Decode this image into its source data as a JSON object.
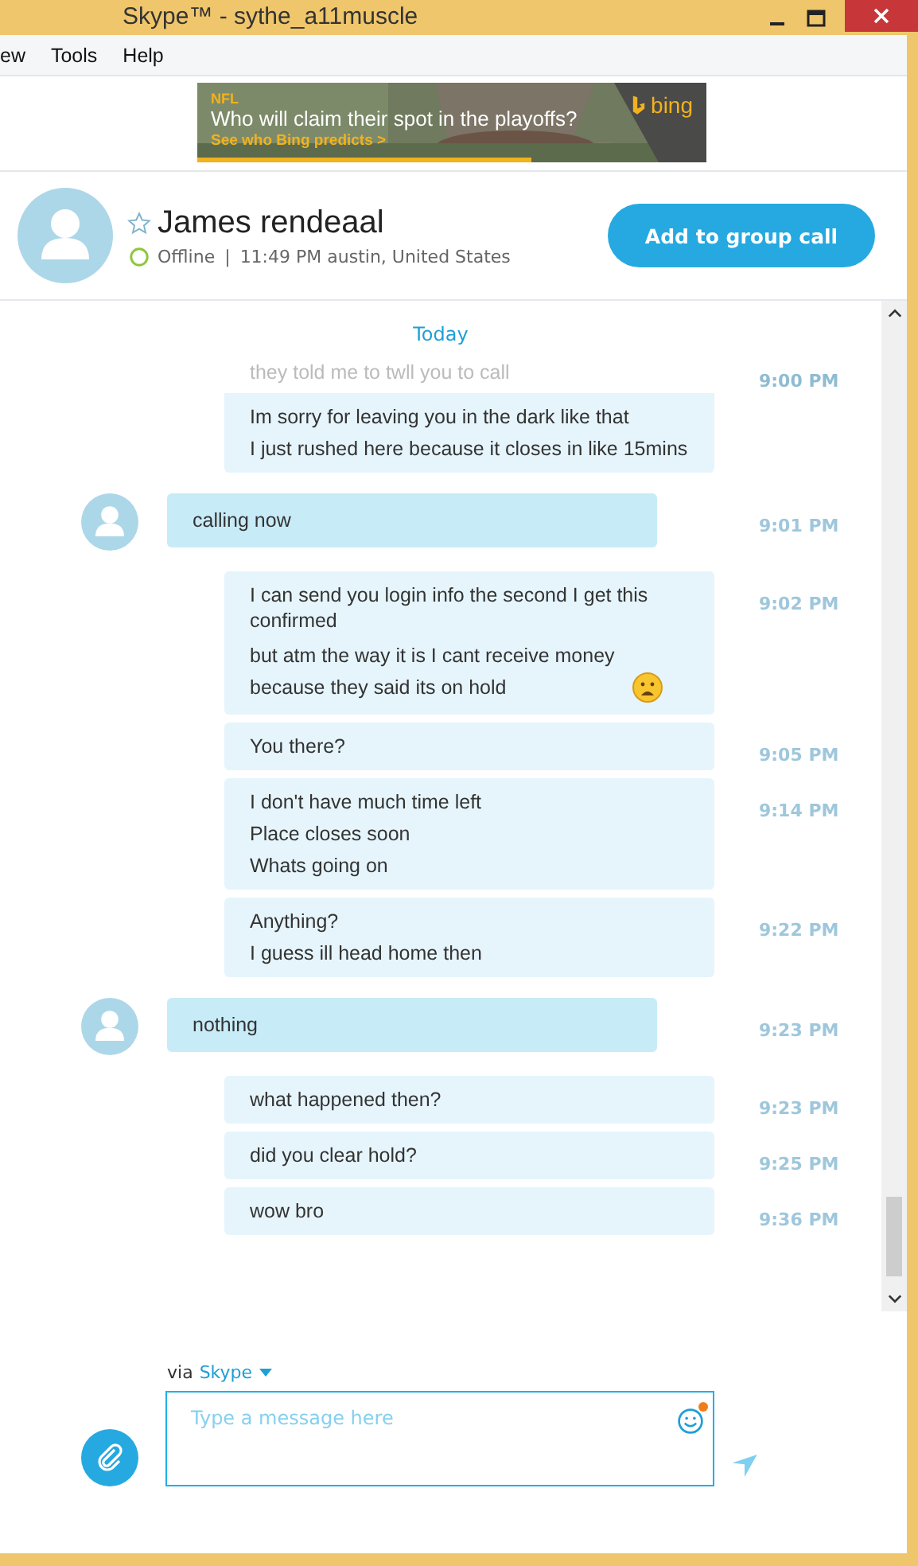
{
  "window": {
    "title": "Skype™ - sythe_a11muscle"
  },
  "menu": [
    "ew",
    "Tools",
    "Help"
  ],
  "ad": {
    "tag": "NFL",
    "headline": "Who will claim their spot in the playoffs?",
    "link": "See who Bing predicts >",
    "brand": "bing"
  },
  "contact": {
    "name": "James rendeaal",
    "favorite": false,
    "status": "Offline",
    "separator": "|",
    "local_time": "11:49 PM austin, United States",
    "action": "Add to group call"
  },
  "day_label": "Today",
  "messages": [
    {
      "kind": "outgoing",
      "cut": true,
      "lines": [
        "they told me to twll you to call"
      ],
      "time": "9:00 PM"
    },
    {
      "kind": "outgoing",
      "cut": false,
      "lines": [
        "Im sorry for leaving you in the dark like that",
        "I just rushed here because it closes in like 15mins"
      ]
    },
    {
      "kind": "incoming",
      "lines": [
        "calling now"
      ],
      "time": "9:01 PM"
    },
    {
      "kind": "outgoing",
      "lines": [
        "I can send you login info the second I get this confirmed",
        "but atm the way it is I cant receive money because they said its on hold"
      ],
      "emoticon": true,
      "time": "9:02 PM"
    },
    {
      "kind": "outgoing",
      "lines": [
        "You there?"
      ],
      "time": "9:05 PM"
    },
    {
      "kind": "outgoing",
      "lines": [
        "I don't have much time left",
        "Place closes soon",
        "Whats going on"
      ],
      "time": "9:14 PM"
    },
    {
      "kind": "outgoing",
      "lines": [
        "Anything?",
        "I guess ill head home then"
      ],
      "time": "9:22 PM"
    },
    {
      "kind": "incoming",
      "lines": [
        "nothing"
      ],
      "time": "9:23 PM"
    },
    {
      "kind": "outgoing",
      "lines": [
        "what happened then?"
      ],
      "time": "9:23 PM"
    },
    {
      "kind": "outgoing",
      "lines": [
        "did you clear hold?"
      ],
      "time": "9:25 PM"
    },
    {
      "kind": "outgoing",
      "lines": [
        "wow bro"
      ],
      "time": "9:36 PM"
    }
  ],
  "composer": {
    "via": "via",
    "service": "Skype",
    "placeholder": "Type a message here",
    "emoji_notification": true
  }
}
